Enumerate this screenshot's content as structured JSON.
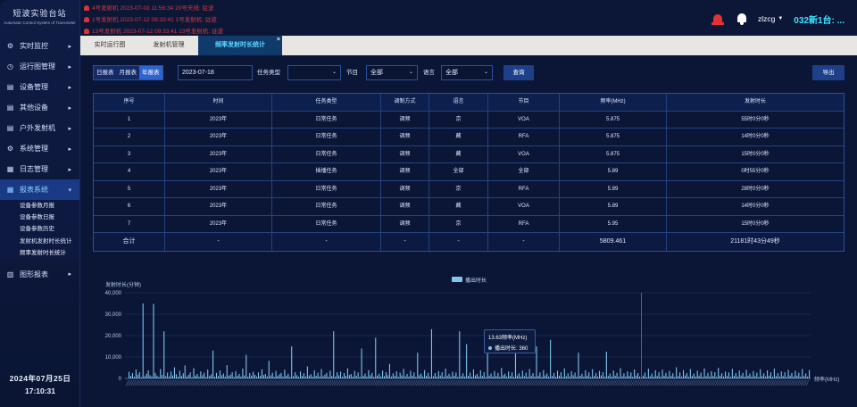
{
  "sidebar": {
    "title": "短波实验台站",
    "subtitle": "Automatic Control System of Transmitter",
    "items": [
      {
        "label": "实时监控",
        "icon": "gear-icon"
      },
      {
        "label": "运行图管理",
        "icon": "clock-icon"
      },
      {
        "label": "设备管理",
        "icon": "device-icon"
      },
      {
        "label": "其他设备",
        "icon": "device-icon"
      },
      {
        "label": "户外发射机",
        "icon": "device-icon"
      },
      {
        "label": "系统管理",
        "icon": "gear-icon"
      },
      {
        "label": "日志管理",
        "icon": "log-icon"
      },
      {
        "label": "报表系统",
        "icon": "grid-icon"
      },
      {
        "label": "图形报表",
        "icon": "chart-icon"
      }
    ],
    "subitems": [
      "设备参数月报",
      "设备参数日报",
      "设备参数历史",
      "发射机发射时长统计",
      "频率发射时长统计"
    ],
    "date": "2024年07月25日",
    "time": "17:10:31"
  },
  "alarms": [
    {
      "text": "4号发射机 2023-07-03 11:56:34  20号天线: 驻波"
    },
    {
      "text": "1号发射机 2023-07-12 09:33:41  1号发射机: 驻波"
    },
    {
      "text": "13号发射机 2023-07-12 09:33:41  13号发射机: 驻波"
    }
  ],
  "header": {
    "user": "zlzcg",
    "station": "032新1台: ..."
  },
  "tabs": [
    {
      "label": "实时运行图"
    },
    {
      "label": "发射机管理"
    },
    {
      "label": "频率发射时长统计"
    }
  ],
  "filters": {
    "segments": [
      "日报表",
      "月报表",
      "年报表"
    ],
    "date": "2023-07-18",
    "task_type_label": "任务类型",
    "task_type_value": "",
    "program_label": "节目",
    "program_value": "全部",
    "language_label": "语言",
    "language_value": "全部",
    "query": "查询",
    "export": "导出"
  },
  "table": {
    "headers": [
      "序号",
      "时间",
      "任务类型",
      "调制方式",
      "语言",
      "节目",
      "频率(MHz)",
      "发射时长"
    ],
    "rows": [
      [
        "1",
        "2023年",
        "日常任务",
        "调频",
        "京",
        "VOA",
        "5.875",
        "55时0分0秒"
      ],
      [
        "2",
        "2023年",
        "日常任务",
        "调频",
        "藏",
        "RFA",
        "5.875",
        "14时0分0秒"
      ],
      [
        "3",
        "2023年",
        "日常任务",
        "调频",
        "藏",
        "VOA",
        "5.875",
        "15时0分0秒"
      ],
      [
        "4",
        "2023年",
        "插播任务",
        "调频",
        "全部",
        "全部",
        "5.89",
        "0时55分0秒"
      ],
      [
        "5",
        "2023年",
        "日常任务",
        "调频",
        "京",
        "RFA",
        "5.89",
        "28时0分0秒"
      ],
      [
        "6",
        "2023年",
        "日常任务",
        "调频",
        "藏",
        "VOA",
        "5.89",
        "14时0分0秒"
      ],
      [
        "7",
        "2023年",
        "日常任务",
        "调频",
        "京",
        "RFA",
        "5.95",
        "15时0分0秒"
      ]
    ],
    "total": [
      "合计",
      "-",
      "-",
      "-",
      "-",
      "-",
      "5809.461",
      "21181时43分49秒"
    ]
  },
  "chart_data": {
    "type": "bar",
    "legend": [
      "播出时长"
    ],
    "ylabel": "发射时长(分钟)",
    "xlabel": "频率(MHz)",
    "ylim": [
      0,
      40000
    ],
    "yticks": [
      "40,000",
      "30,000",
      "20,000",
      "10,000",
      "0"
    ],
    "legend_position": "top-center",
    "grid": true,
    "tooltip": {
      "title": "13.63频率(MHz)",
      "label": "播出时长",
      "value": "360"
    },
    "series": [
      {
        "name": "播出时长",
        "values": [
          3100,
          1200,
          2500,
          800,
          4200,
          1800,
          2900,
          600,
          35000,
          1100,
          2200,
          3800,
          1500,
          900,
          34800,
          2600,
          1300,
          700,
          4400,
          1600,
          22000,
          1100,
          2700,
          900,
          3200,
          1400,
          5200,
          2000,
          800,
          3600,
          1200,
          2400,
          6100,
          900,
          1700,
          2800,
          600,
          4800,
          1300,
          2100,
          900,
          3300,
          1500,
          2700,
          700,
          4100,
          1200,
          1900,
          13000,
          800,
          2600,
          1100,
          3700,
          1500,
          2300,
          900,
          6200,
          1300,
          1800,
          2900,
          700,
          3400,
          1200,
          2100,
          900,
          4600,
          1400,
          11000,
          800,
          2500,
          1300,
          3100,
          1700,
          900,
          2800,
          1200,
          4300,
          1600,
          2100,
          900,
          8200,
          1400,
          2700,
          800,
          3500,
          1200,
          1900,
          2600,
          900,
          4100,
          1300,
          2200,
          700,
          15000,
          1100,
          2900,
          1500,
          800,
          3300,
          1200,
          2400,
          900,
          5600,
          1400,
          2000,
          800,
          3800,
          1300,
          2700,
          900,
          4400,
          1100,
          1800,
          2600,
          700,
          3600,
          1200,
          22000,
          900,
          2900,
          1400,
          3200,
          800,
          2500,
          1200,
          4700,
          1600,
          2100,
          900,
          3500,
          1300,
          2800,
          700,
          14000,
          1200,
          2300,
          900,
          3900,
          1500,
          2600,
          800,
          19000,
          1300,
          2200,
          900,
          3700,
          1100,
          2900,
          1500,
          6800,
          900,
          2400,
          1200,
          3300,
          800,
          2700,
          1400,
          4500,
          1000,
          2100,
          900,
          3600,
          1300,
          2800,
          700,
          12000,
          1500,
          2300,
          900,
          3900,
          1200,
          2600,
          800,
          23000,
          1100,
          2500,
          900,
          3400,
          1400,
          2900,
          800,
          4600,
          1200,
          2200,
          900,
          3100,
          1300,
          2800,
          700,
          22000,
          1100,
          2400,
          900,
          16000,
          1200,
          2700,
          800,
          4200,
          1400,
          2100,
          900,
          3800,
          1200,
          2900,
          700,
          20000,
          1300,
          2300,
          900,
          3500,
          1100,
          2600,
          800,
          4900,
          1500,
          2200,
          900,
          3300,
          1200,
          2800,
          700,
          14000,
          1400,
          2400,
          900,
          3700,
          1100,
          2700,
          800,
          4400,
          1300,
          2500,
          900,
          15000,
          1200,
          2800,
          700,
          3900,
          1400,
          2300,
          900,
          18000,
          1200,
          2600,
          800,
          3600,
          1300,
          2900,
          700,
          4700,
          1100,
          2400,
          900,
          3400,
          1500,
          2700,
          800,
          12000,
          1200,
          2200,
          900,
          3800,
          1300,
          2800,
          700,
          4300,
          1100,
          2500,
          900,
          3500,
          1400,
          2900,
          800,
          12500,
          1200,
          2300,
          900,
          3700,
          1300,
          2600,
          700,
          4800,
          1100,
          2400,
          900,
          3300,
          1200,
          2800,
          800,
          4200,
          1400,
          2500,
          900,
          360,
          1300,
          2700,
          700,
          4600,
          1100,
          2300,
          900,
          3800,
          1200,
          2900,
          800,
          4100,
          1300,
          2600,
          900,
          3500,
          1200,
          2400,
          700,
          5200,
          1100,
          2800,
          900,
          3900,
          1400,
          2500,
          800,
          4400,
          1200,
          2300,
          900,
          3600,
          1300,
          2700,
          700,
          4700,
          1100,
          2600,
          900,
          3400,
          1200,
          2900,
          800,
          4900,
          1300,
          2400,
          900,
          3200,
          1100,
          2800,
          700,
          4500,
          1200,
          2500,
          900,
          3700,
          1400,
          2600,
          800,
          4100,
          1300,
          2300,
          900,
          3500,
          1100,
          2700,
          700,
          4300,
          1200,
          2400,
          900,
          3800,
          1300,
          2800,
          800,
          4600,
          1100,
          2500,
          900,
          3300,
          1200,
          2900,
          700,
          4000,
          1400,
          2600,
          900,
          3600,
          1300,
          2700,
          800,
          4400,
          1100,
          2300,
          900,
          3900
        ]
      }
    ]
  }
}
